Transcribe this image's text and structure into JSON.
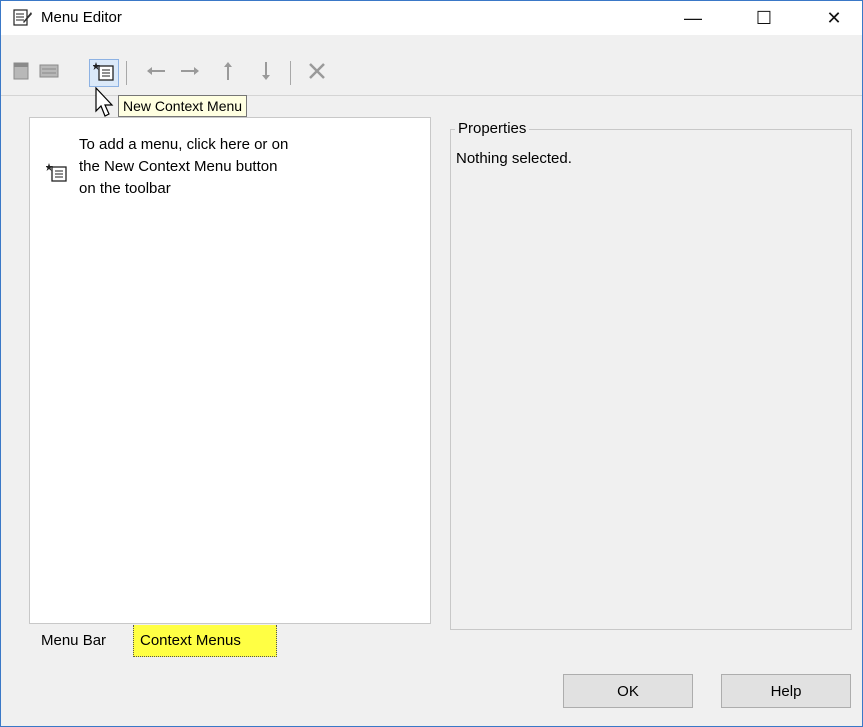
{
  "window": {
    "title": "Menu Editor",
    "controls": {
      "minimize": "—",
      "maximize": "☐",
      "close": "✕"
    }
  },
  "toolbar": {
    "buttons": [
      {
        "name": "new-menu-button",
        "icon": "new-menu-icon",
        "enabled": false
      },
      {
        "name": "new-menu-item-button",
        "icon": "new-menu-item-icon",
        "enabled": false
      },
      {
        "name": "new-context-menu-button",
        "icon": "new-context-menu-icon",
        "enabled": true
      },
      {
        "name": "move-left-button",
        "icon": "arrow-left-icon",
        "enabled": false
      },
      {
        "name": "move-right-button",
        "icon": "arrow-right-icon",
        "enabled": false
      },
      {
        "name": "move-up-button",
        "icon": "arrow-up-icon",
        "enabled": false
      },
      {
        "name": "move-down-button",
        "icon": "arrow-down-icon",
        "enabled": false
      },
      {
        "name": "delete-button",
        "icon": "delete-icon",
        "enabled": false
      }
    ],
    "tooltip": "New Context Menu"
  },
  "tree": {
    "hint_lines": [
      "To add a menu, click here or on",
      "the New Context Menu button",
      "on the toolbar"
    ]
  },
  "tabs": [
    {
      "label": "Menu Bar",
      "active": false
    },
    {
      "label": "Context Menus",
      "active": true
    }
  ],
  "properties": {
    "legend": "Properties",
    "text": "Nothing selected."
  },
  "buttons": {
    "ok": "OK",
    "help": "Help"
  },
  "colors": {
    "active_tab": "#ffff44",
    "tooltip_bg": "#ffffe1",
    "window_bg": "#f0f0f0"
  }
}
